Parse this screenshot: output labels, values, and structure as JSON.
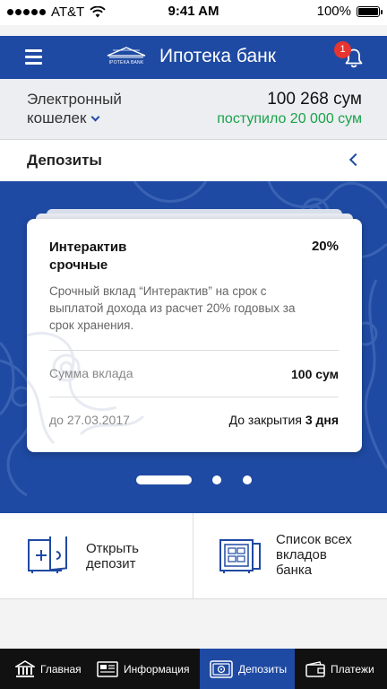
{
  "status_bar": {
    "carrier": "AT&T",
    "time": "9:41 AM",
    "battery": "100%",
    "icons": [
      "signal-dots-icon",
      "wifi-icon",
      "battery-icon"
    ]
  },
  "header": {
    "menu_icon": "hamburger-menu-icon",
    "logo_text": "IPOTEKA BANK",
    "title": "Ипотека банк",
    "notification_icon": "bell-icon",
    "notification_count": "1"
  },
  "wallet": {
    "label_line1": "Электронный",
    "label_line2": "кошелек",
    "amount": "100 268 сум",
    "income": "поступило 20 000 сум"
  },
  "section": {
    "title": "Депозиты",
    "back_icon": "chevron-left-icon"
  },
  "deposit_card": {
    "title_line1": "Интерактив",
    "title_line2": "срочные",
    "rate": "20%",
    "description": "Срочный вклад “Интерактив” на срок с выплатой дохода из расчет 20% годовых за срок хранения.",
    "amount_label": "Сумма вклада",
    "amount_value": "100 сум",
    "date_label": "до 27.03.2017",
    "close_prefix": "До закрытия",
    "close_value": "3 дня"
  },
  "pager": {
    "pages": 3,
    "active": 1
  },
  "actions": [
    {
      "icon": "open-deposit-safe-icon",
      "line1": "Открыть",
      "line2": "депозит",
      "line3": ""
    },
    {
      "icon": "deposit-list-safe-icon",
      "line1": "Список всех",
      "line2": "вкладов",
      "line3": "банка"
    }
  ],
  "tabbar": {
    "active_tab": "Депозиты",
    "tabs": [
      {
        "label": "Главная",
        "icon": "bank-building-icon"
      },
      {
        "label": "Информация",
        "icon": "newspaper-icon"
      },
      {
        "label": "Депозиты",
        "icon": "safe-icon"
      },
      {
        "label": "Платежи",
        "icon": "wallet-icon"
      }
    ]
  },
  "colors": {
    "brand_blue": "#1f4aa3",
    "income_green": "#1aa24b",
    "badge_red": "#e8342f",
    "tabbar_bg": "#111111"
  }
}
